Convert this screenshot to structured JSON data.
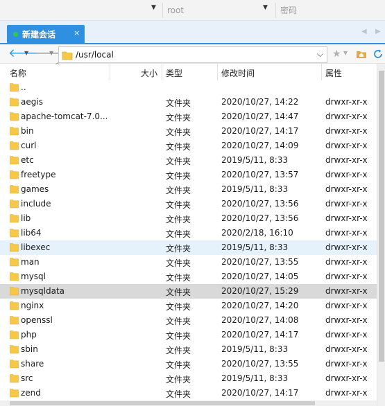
{
  "topbar": {
    "user": "root",
    "password_placeholder": "密码"
  },
  "tab": {
    "title": "新建会话",
    "close": "×"
  },
  "address": {
    "path": "/usr/local"
  },
  "columns": {
    "name": "名称",
    "size": "大小",
    "type": "类型",
    "mtime": "修改时间",
    "perm": "属性"
  },
  "colors": {
    "accent": "#2f8fe0",
    "selected_row": "#d9d9d9",
    "hover_row": "#e5f1fb",
    "folder": "#f5c84a",
    "online_dot": "#31c94a"
  },
  "files": [
    {
      "name": "..",
      "type": "",
      "mtime": "",
      "perm": ""
    },
    {
      "name": "aegis",
      "type": "文件夹",
      "mtime": "2020/10/27, 14:22",
      "perm": "drwxr-xr-x"
    },
    {
      "name": "apache-tomcat-7.0....",
      "type": "文件夹",
      "mtime": "2020/10/27, 14:47",
      "perm": "drwxr-xr-x"
    },
    {
      "name": "bin",
      "type": "文件夹",
      "mtime": "2020/10/27, 14:17",
      "perm": "drwxr-xr-x"
    },
    {
      "name": "curl",
      "type": "文件夹",
      "mtime": "2020/10/27, 14:09",
      "perm": "drwxr-xr-x"
    },
    {
      "name": "etc",
      "type": "文件夹",
      "mtime": "2019/5/11, 8:33",
      "perm": "drwxr-xr-x"
    },
    {
      "name": "freetype",
      "type": "文件夹",
      "mtime": "2020/10/27, 13:57",
      "perm": "drwxr-xr-x"
    },
    {
      "name": "games",
      "type": "文件夹",
      "mtime": "2019/5/11, 8:33",
      "perm": "drwxr-xr-x"
    },
    {
      "name": "include",
      "type": "文件夹",
      "mtime": "2020/10/27, 13:56",
      "perm": "drwxr-xr-x"
    },
    {
      "name": "lib",
      "type": "文件夹",
      "mtime": "2020/10/27, 13:56",
      "perm": "drwxr-xr-x"
    },
    {
      "name": "lib64",
      "type": "文件夹",
      "mtime": "2020/2/18, 16:10",
      "perm": "drwxr-xr-x"
    },
    {
      "name": "libexec",
      "type": "文件夹",
      "mtime": "2019/5/11, 8:33",
      "perm": "drwxr-xr-x",
      "state": "hover"
    },
    {
      "name": "man",
      "type": "文件夹",
      "mtime": "2020/10/27, 13:55",
      "perm": "drwxr-xr-x"
    },
    {
      "name": "mysql",
      "type": "文件夹",
      "mtime": "2020/10/27, 14:05",
      "perm": "drwxr-xr-x"
    },
    {
      "name": "mysqldata",
      "type": "文件夹",
      "mtime": "2020/10/27, 15:29",
      "perm": "drwxr-xr-x",
      "state": "selected"
    },
    {
      "name": "nginx",
      "type": "文件夹",
      "mtime": "2020/10/27, 14:20",
      "perm": "drwxr-xr-x"
    },
    {
      "name": "openssl",
      "type": "文件夹",
      "mtime": "2020/10/27, 14:08",
      "perm": "drwxr-xr-x"
    },
    {
      "name": "php",
      "type": "文件夹",
      "mtime": "2020/10/27, 14:17",
      "perm": "drwxr-xr-x"
    },
    {
      "name": "sbin",
      "type": "文件夹",
      "mtime": "2019/5/11, 8:33",
      "perm": "drwxr-xr-x"
    },
    {
      "name": "share",
      "type": "文件夹",
      "mtime": "2020/10/27, 13:55",
      "perm": "drwxr-xr-x"
    },
    {
      "name": "src",
      "type": "文件夹",
      "mtime": "2019/5/11, 8:33",
      "perm": "drwxr-xr-x"
    },
    {
      "name": "zend",
      "type": "文件夹",
      "mtime": "2020/10/27, 14:17",
      "perm": "drwxr-xr-x"
    }
  ]
}
